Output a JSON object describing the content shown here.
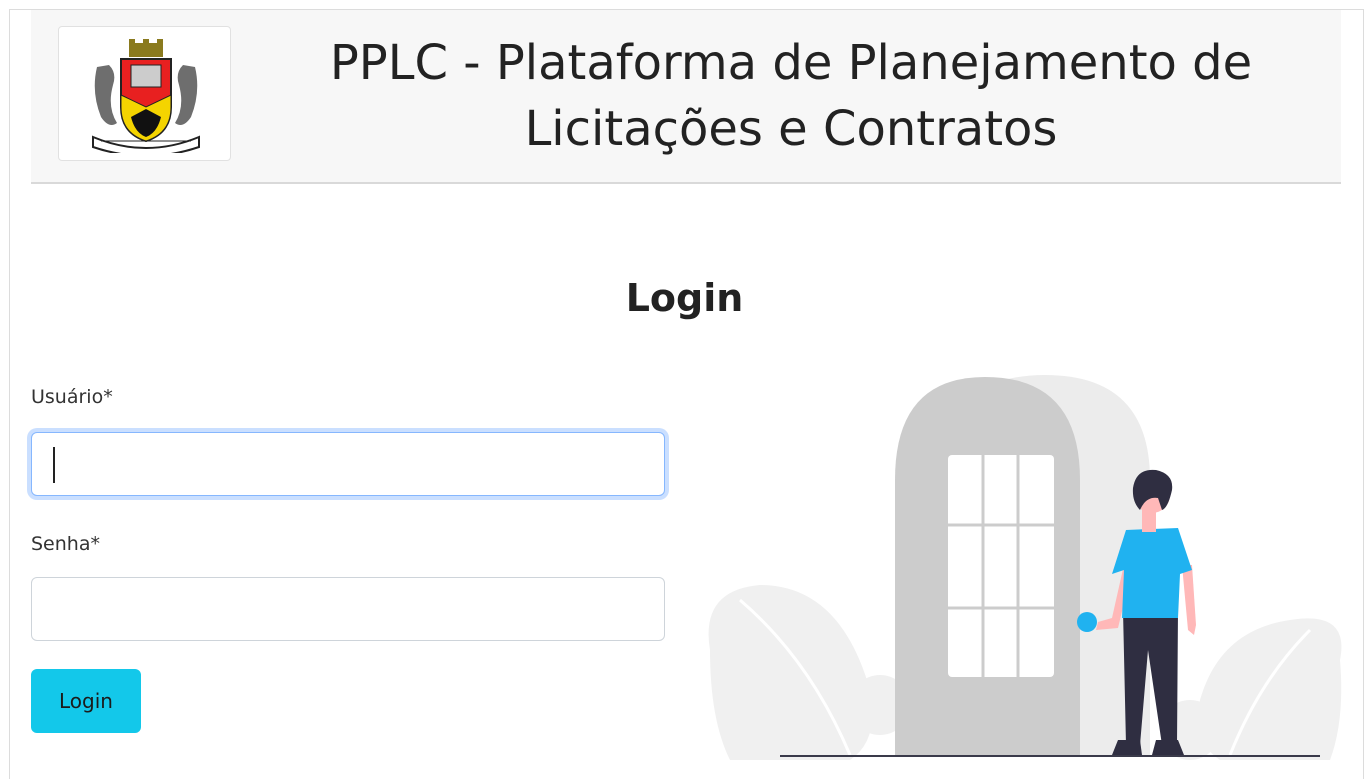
{
  "header": {
    "title_line1": "PPLC - Plataforma de Planejamento de",
    "title_line2": "Licitações e Contratos"
  },
  "login": {
    "heading": "Login",
    "username_label": "Usuário*",
    "username_value": "",
    "password_label": "Senha*",
    "password_value": "",
    "submit_label": "Login"
  },
  "colors": {
    "button": "#13c8ea",
    "focus_ring": "#86b7fe",
    "header_bg": "#f7f7f7",
    "shirt": "#20b2f0",
    "door": "#cccccc"
  }
}
